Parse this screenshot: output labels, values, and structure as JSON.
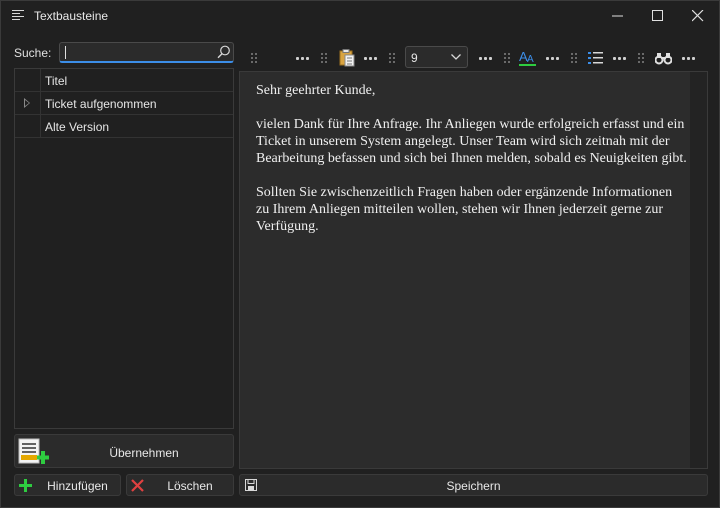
{
  "window": {
    "title": "Textbausteine",
    "controls": [
      "minimize-icon",
      "maximize-icon",
      "close-icon"
    ]
  },
  "search": {
    "label": "Suche:",
    "value": "",
    "placeholder": ""
  },
  "grid": {
    "column_header": "Titel",
    "rows": [
      {
        "title": "Ticket aufgenommen",
        "current": true
      },
      {
        "title": "Alte Version",
        "current": false
      }
    ]
  },
  "buttons": {
    "apply": "Übernehmen",
    "add": "Hinzufügen",
    "delete": "Löschen",
    "save": "Speichern"
  },
  "toolbar": {
    "font_size": "9",
    "icons": [
      "paste-icon",
      "font-color-icon",
      "list-icon",
      "find-icon"
    ]
  },
  "editor": {
    "paragraphs": [
      "Sehr geehrter Kunde,",
      "vielen Dank für Ihre Anfrage. Ihr Anliegen wurde erfolgreich erfasst und ein Ticket in unserem System angelegt. Unser Team wird sich zeitnah mit der Bearbeitung befassen und sich bei Ihnen melden, sobald es Neuigkeiten gibt.",
      "Sollten Sie zwischenzeitlich Fragen haben oder ergänzende Informationen zu Ihrem Anliegen mitteilen wollen, stehen wir Ihnen jederzeit gerne zur Verfügung."
    ]
  },
  "colors": {
    "background": "#202020",
    "accent": "#3c8ee8",
    "add_green": "#2ecc40",
    "delete_red": "#e04040"
  }
}
